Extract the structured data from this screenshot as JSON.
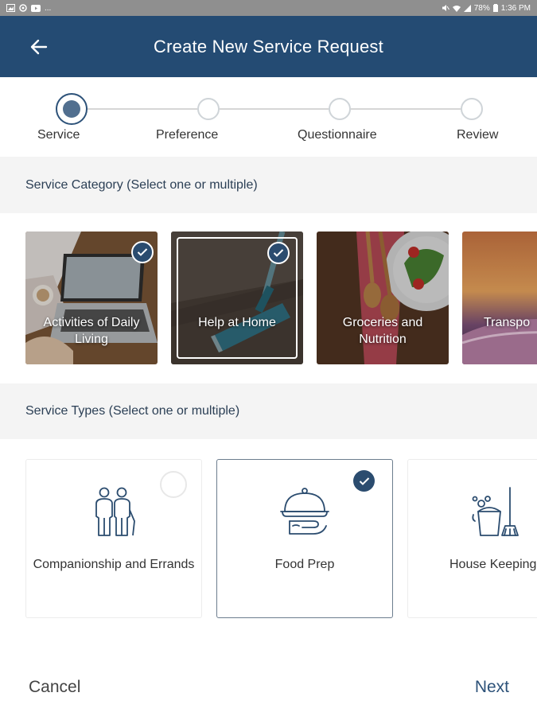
{
  "status_bar": {
    "left_icons": [
      "gallery-icon",
      "settings-icon",
      "youtube-icon",
      "more-icon"
    ],
    "left_more": "...",
    "battery": "78%",
    "time": "1:36 PM"
  },
  "header": {
    "title": "Create New Service Request"
  },
  "stepper": {
    "steps": [
      {
        "label": "Service",
        "active": true
      },
      {
        "label": "Preference",
        "active": false
      },
      {
        "label": "Questionnaire",
        "active": false
      },
      {
        "label": "Review",
        "active": false
      }
    ]
  },
  "category_section": {
    "title": "Service Category (Select one or multiple)",
    "items": [
      {
        "label": "Activities of Daily Living",
        "selected": true
      },
      {
        "label": "Help at Home",
        "selected": true
      },
      {
        "label": "Groceries and Nutrition",
        "selected": false
      },
      {
        "label": "Transpo",
        "selected": false
      }
    ]
  },
  "types_section": {
    "title": "Service Types (Select one or multiple)",
    "items": [
      {
        "label": "Companionship and Errands",
        "icon": "people-icon",
        "selected": false
      },
      {
        "label": "Food Prep",
        "icon": "cloche-icon",
        "selected": true
      },
      {
        "label": "House Keeping",
        "icon": "cleaning-bucket-icon",
        "selected": false
      }
    ]
  },
  "footer": {
    "cancel_label": "Cancel",
    "next_label": "Next"
  },
  "colors": {
    "header_bg": "#244b73",
    "accent": "#2d5279",
    "status_bar_bg": "#8f8f8f",
    "section_bg": "#f4f4f4"
  }
}
